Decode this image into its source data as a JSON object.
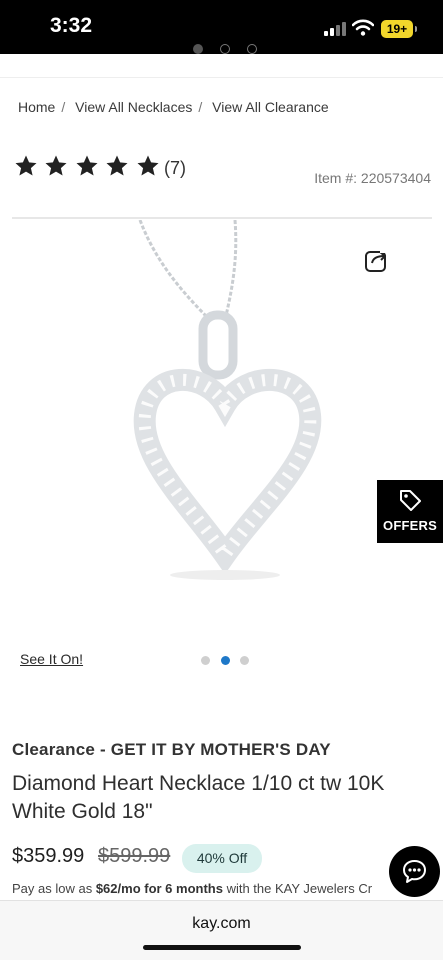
{
  "status_bar": {
    "time": "3:32",
    "battery": "19+"
  },
  "breadcrumb": [
    {
      "label": "Home"
    },
    {
      "label": "View All Necklaces"
    },
    {
      "label": "View All Clearance"
    }
  ],
  "rating": {
    "stars": 5,
    "count_label": "(7)"
  },
  "item_number": "Item #: 220573404",
  "offers": {
    "label": "OFFERS"
  },
  "gallery": {
    "see_it_on": "See It On!",
    "dots": 3,
    "active_dot": 1
  },
  "product": {
    "promo": "Clearance - GET IT BY MOTHER'S DAY",
    "title": "Diamond Heart Necklace 1/10 ct tw 10K White Gold 18\"",
    "price": "$359.99",
    "original_price": "$599.99",
    "discount": "40% Off",
    "finance_prefix": "Pay as low as ",
    "finance_amount": "$62/mo for 6 months",
    "finance_suffix": " with the KAY Jewelers Cr"
  },
  "browser": {
    "url": "kay.com"
  },
  "colors": {
    "offers_bg": "#000000",
    "discount_bg": "#d9f1ee",
    "active_dot": "#1e78c8"
  }
}
